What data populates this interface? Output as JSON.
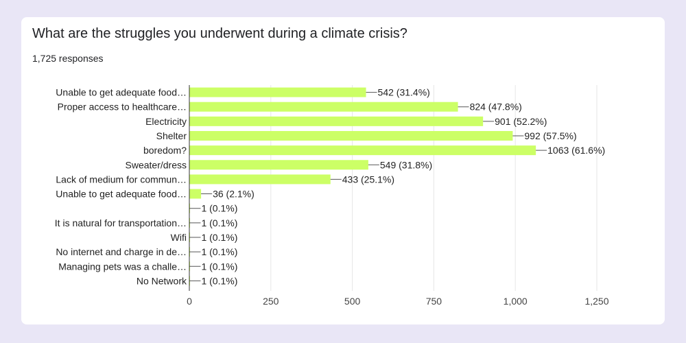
{
  "question": {
    "title": "What are the struggles you underwent during a climate crisis?",
    "responses": "1,725 responses"
  },
  "chart_data": {
    "type": "bar",
    "orientation": "horizontal",
    "categories": [
      "Unable to get adequate food…",
      "Proper access to healthcare…",
      "Electricity",
      "Shelter",
      "boredom?",
      "Sweater/dress",
      "Lack of medium for commun…",
      "Unable to get adequate food…",
      "",
      "It is natural for transportation…",
      "Wifi",
      "No internet and charge in de…",
      "Managing pets was a challe…",
      "No Network"
    ],
    "values": [
      542,
      824,
      901,
      992,
      1063,
      549,
      433,
      36,
      1,
      1,
      1,
      1,
      1,
      1
    ],
    "data_labels": [
      "542 (31.4%)",
      "824 (47.8%)",
      "901 (52.2%)",
      "992 (57.5%)",
      "1063 (61.6%)",
      "549 (31.8%)",
      "433 (25.1%)",
      "36 (2.1%)",
      "1 (0.1%)",
      "1 (0.1%)",
      "1 (0.1%)",
      "1 (0.1%)",
      "1 (0.1%)",
      "1 (0.1%)"
    ],
    "xlim": [
      0,
      1250
    ],
    "xticks": [
      0,
      250,
      500,
      750,
      1000,
      1250
    ],
    "xtick_labels": [
      "0",
      "250",
      "500",
      "750",
      "1,000",
      "1,250"
    ],
    "grid": true,
    "bar_color": "#ccff66"
  }
}
